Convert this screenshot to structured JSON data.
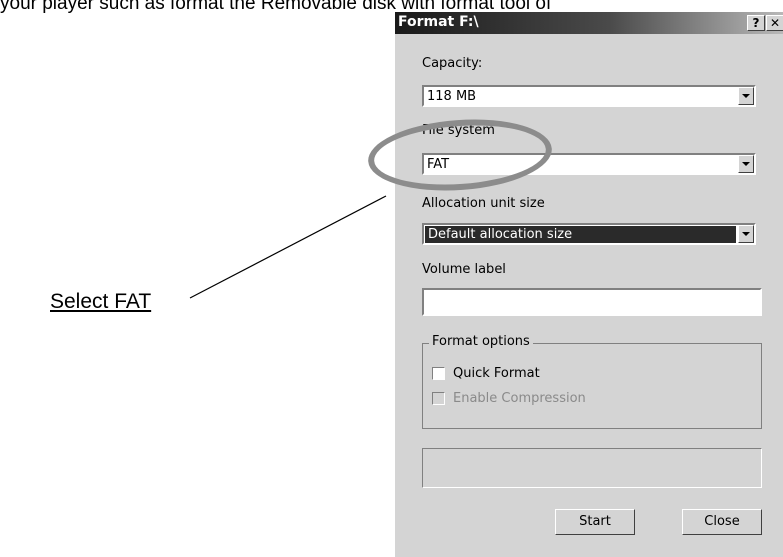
{
  "document": {
    "top_text": "your player such as format the Removable disk with format tool of",
    "annotation_label": "Select FAT"
  },
  "dialog": {
    "title": "Format F:\\",
    "help_button": "?",
    "close_button": "✕",
    "capacity_label": "Capacity:",
    "capacity_value": "118 MB",
    "file_system_label": "File system",
    "file_system_value": "FAT",
    "allocation_label": "Allocation unit size",
    "allocation_value": "Default allocation size",
    "volume_label_label": "Volume label",
    "volume_label_value": "",
    "format_options_title": "Format options",
    "quick_format_label": "Quick Format",
    "enable_compression_label": "Enable Compression",
    "start_button": "Start",
    "close_button_label": "Close"
  }
}
